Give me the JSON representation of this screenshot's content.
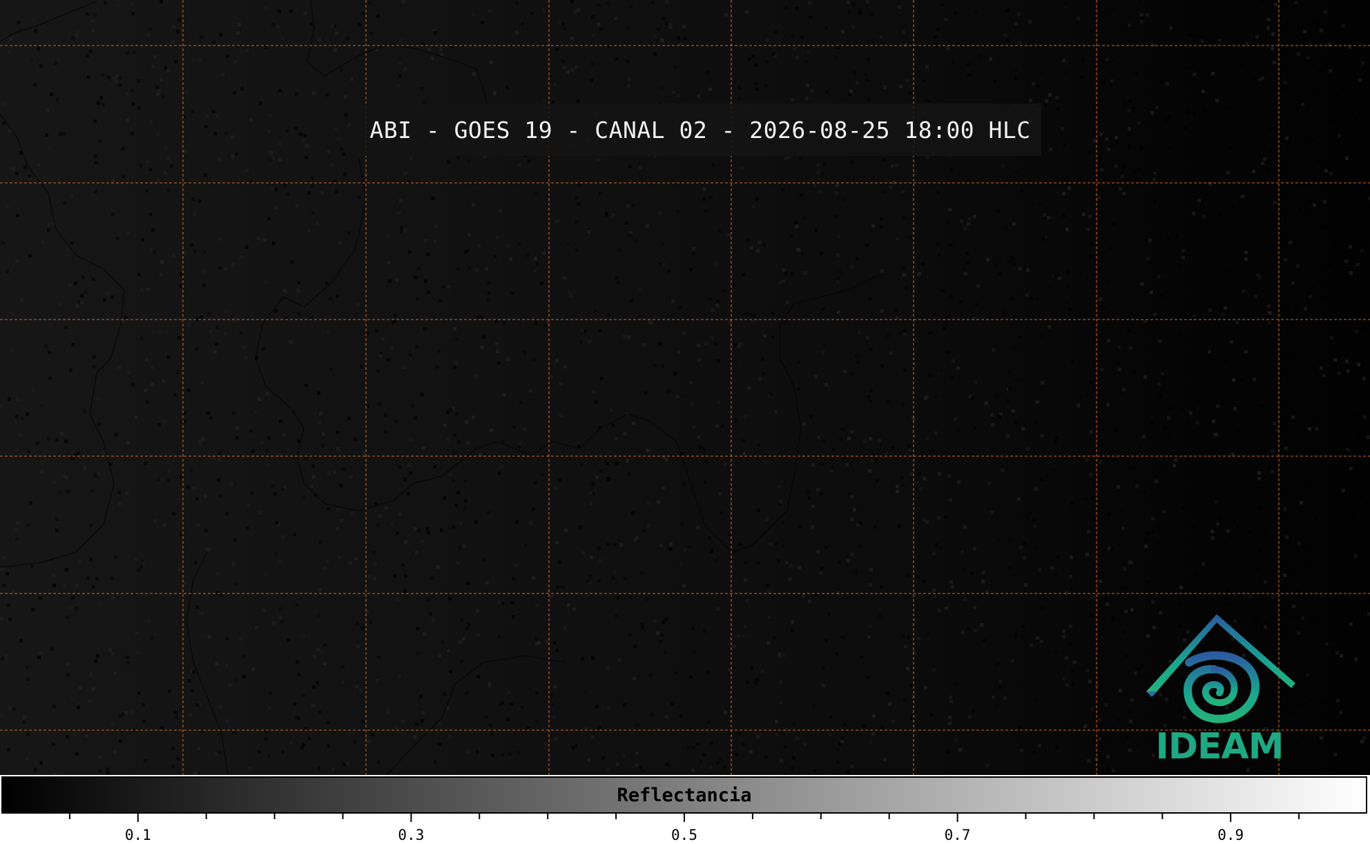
{
  "title": "ABI - GOES 19 - CANAL 02 - 2026-08-25 18:00 HLC",
  "colorbar": {
    "label": "Reflectancia",
    "range": [
      0.0,
      1.0
    ],
    "colormap": "gray",
    "major_ticks": [
      "0.1",
      "0.3",
      "0.5",
      "0.7",
      "0.9"
    ]
  },
  "logo": {
    "text": "IDEAM",
    "colors": [
      "#2a5c9f",
      "#1aa68f",
      "#23b27a"
    ]
  },
  "graticule": {
    "color": "#c8631f",
    "style": "dashed"
  },
  "borders": {
    "color": "#000000"
  }
}
